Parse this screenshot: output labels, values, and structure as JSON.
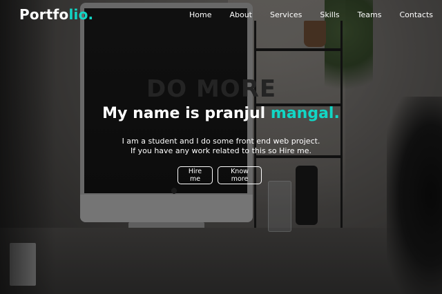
{
  "navbar": {
    "logo_main": "Portfo",
    "logo_accent": "lio.",
    "links": [
      "Home",
      "About",
      "Services",
      "Skills",
      "Teams",
      "Contacts"
    ]
  },
  "hero": {
    "title_main": "My name is pranjul ",
    "title_accent": "mangal.",
    "desc_line1": "I am a student and I do some front end web project.",
    "desc_line2": "If you have any work related to this so Hire me.",
    "hire_button": "Hire me",
    "more_button": "Know more",
    "background_screen_text": "DO MORE"
  },
  "colors": {
    "accent": "#12d6c5",
    "text": "#ffffff"
  }
}
